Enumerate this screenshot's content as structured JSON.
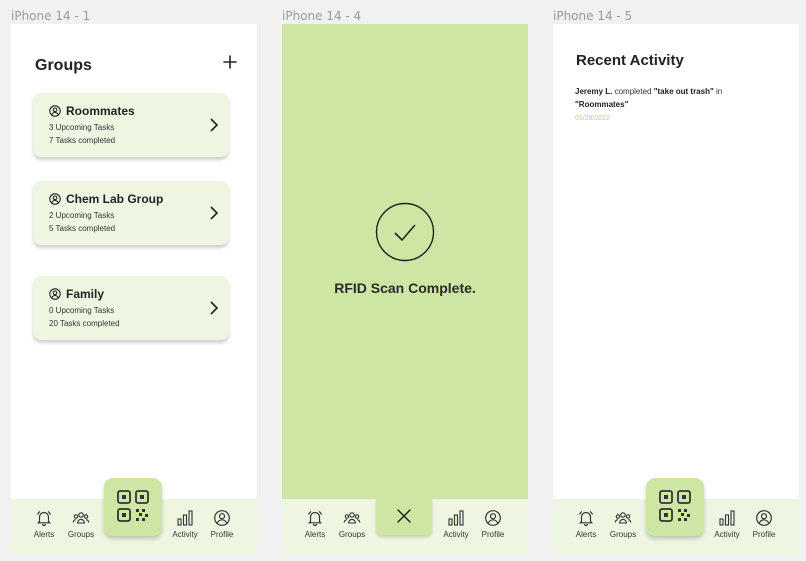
{
  "frames": {
    "frame1_label": "iPhone 14 - 1",
    "frame2_label": "iPhone 14 - 4",
    "frame3_label": "iPhone 14 - 5"
  },
  "groups_screen": {
    "title": "Groups",
    "add_icon": "plus-icon",
    "groups": [
      {
        "name": "Roommates",
        "upcoming": "3 Upcoming Tasks",
        "completed": "7 Tasks completed"
      },
      {
        "name": "Chem Lab Group",
        "upcoming": "2 Upcoming Tasks",
        "completed": "5 Tasks completed"
      },
      {
        "name": "Family",
        "upcoming": "0 Upcoming Tasks",
        "completed": "20 Tasks completed"
      }
    ]
  },
  "scan_screen": {
    "message": "RFID Scan Complete.",
    "icon": "check-circle-icon",
    "close_icon": "close-icon"
  },
  "activity_screen": {
    "title": "Recent Activity",
    "entry": {
      "user": "Jeremy L.",
      "verb": " completed ",
      "task": "\"take out trash\"",
      "connector": " in ",
      "group": "\"Roommates\""
    },
    "date": "01/28/2022"
  },
  "nav": {
    "alerts": "Alerts",
    "groups": "Groups",
    "activity": "Activity",
    "profile": "Profile",
    "qr_icon": "qr-code-icon"
  },
  "colors": {
    "accent": "#cee6a4",
    "accent_light": "#eef6e2",
    "date_text": "#b6d28d"
  }
}
